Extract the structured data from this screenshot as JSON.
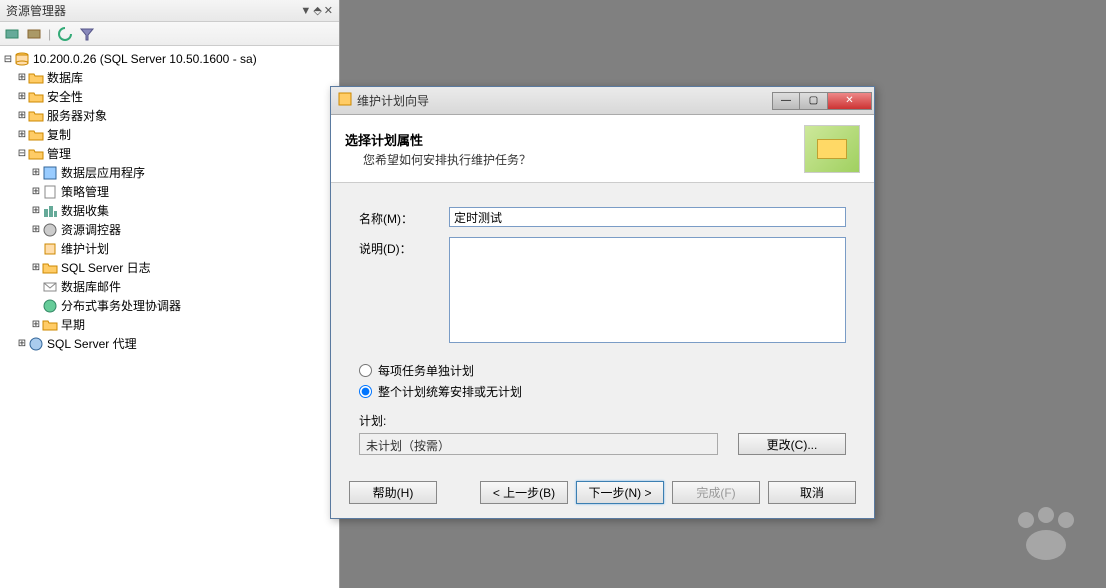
{
  "panel": {
    "title": "资源管理器",
    "pin": "▾ ⬘ ✕",
    "server_root": "10.200.0.26 (SQL Server 10.50.1600 - sa)",
    "nodes": {
      "databases": "数据库",
      "security": "安全性",
      "server_objects": "服务器对象",
      "replication": "复制",
      "management": "管理",
      "data_tier": "数据层应用程序",
      "policy_mgmt": "策略管理",
      "data_collection": "数据收集",
      "resource_governor": "资源调控器",
      "maintenance_plans": "维护计划",
      "sql_logs": "SQL Server 日志",
      "database_mail": "数据库邮件",
      "dtc": "分布式事务处理协调器",
      "legacy": "早期",
      "agent": "SQL Server 代理"
    }
  },
  "dialog": {
    "title": "维护计划向导",
    "banner": {
      "title": "选择计划属性",
      "sub": "您希望如何安排执行维护任务？"
    },
    "form": {
      "name_label": "名称(M)：",
      "name_value": "定时测试",
      "desc_label": "说明(D)：",
      "desc_value": ""
    },
    "radio": {
      "opt1": "每项任务单独计划",
      "opt2": "整个计划统筹安排或无计划"
    },
    "plan": {
      "label": "计划:",
      "value": "未计划（按需）",
      "change_btn": "更改(C)..."
    },
    "buttons": {
      "help": "帮助(H)",
      "back": "< 上一步(B)",
      "next": "下一步(N) >",
      "finish": "完成(F)",
      "cancel": "取消"
    }
  }
}
